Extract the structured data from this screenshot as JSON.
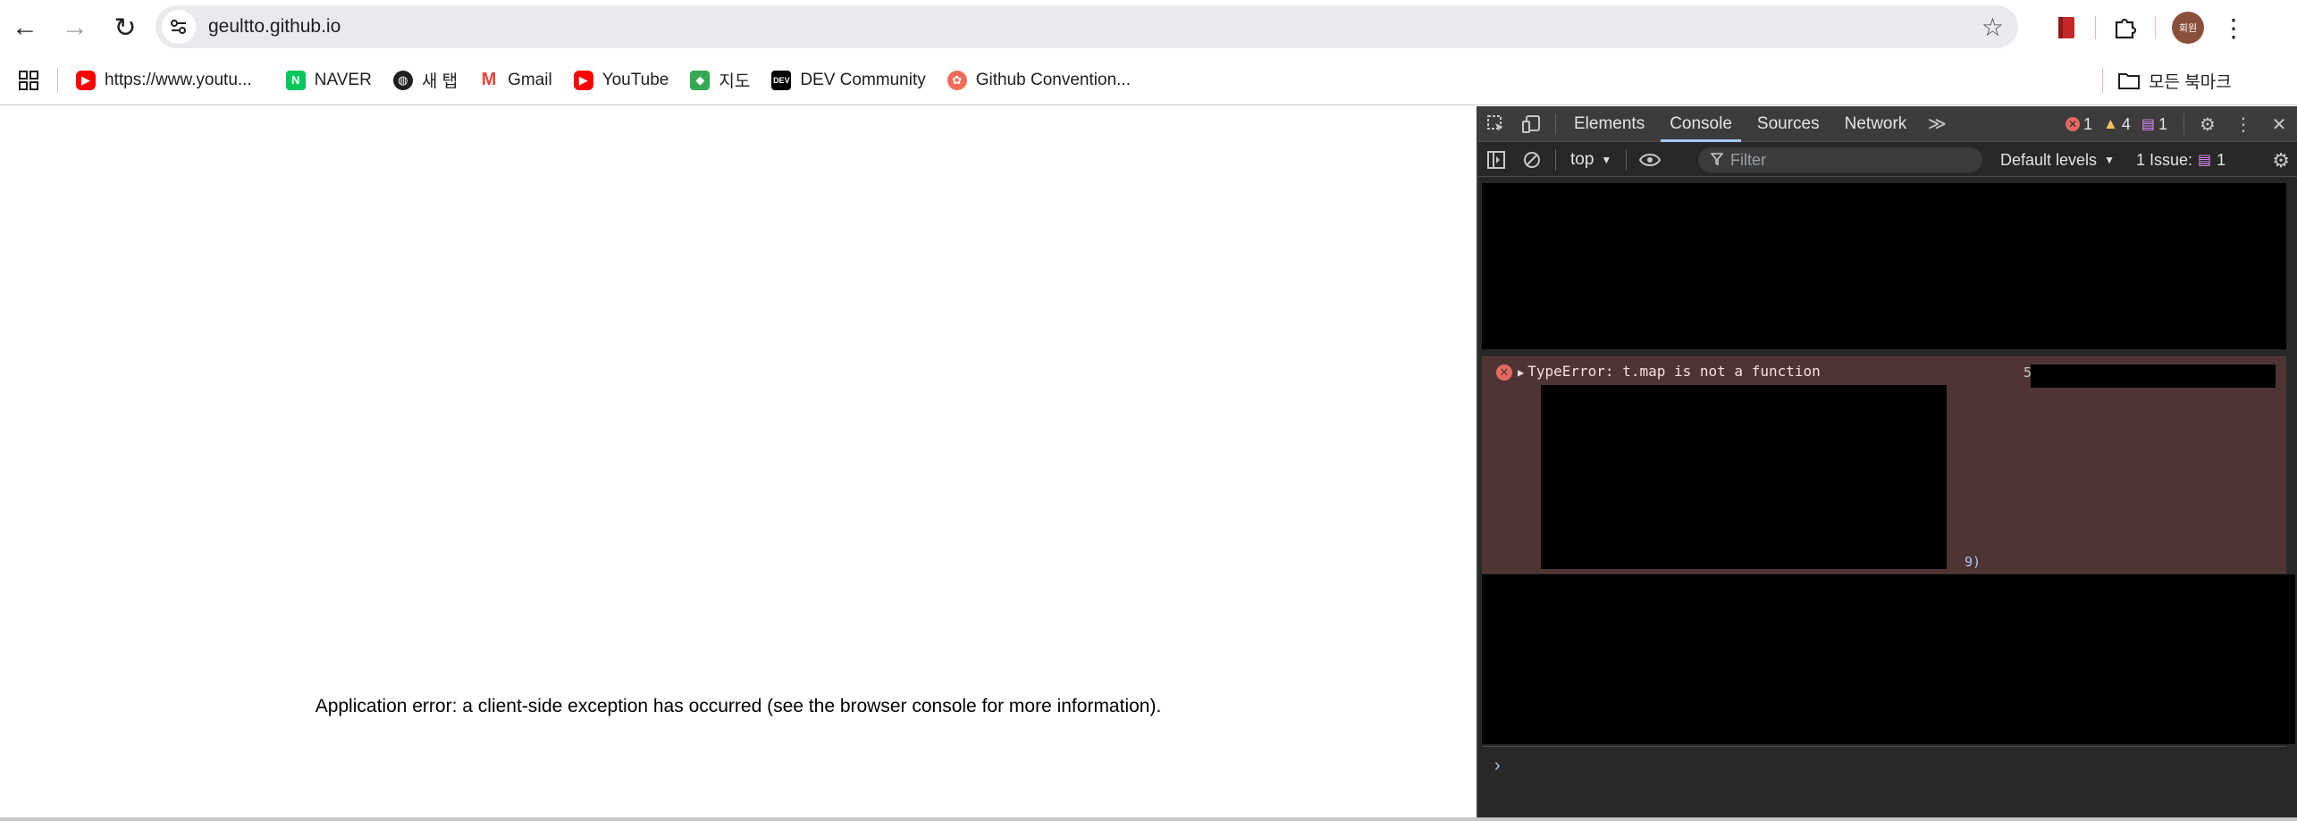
{
  "browser": {
    "url": "geultto.github.io",
    "back_icon": "←",
    "forward_icon": "→",
    "reload_icon": "↻",
    "star_icon": "☆",
    "menu_icon": "⋮",
    "profile_label": "회원"
  },
  "bookmarks": {
    "items": [
      {
        "label": "https://www.youtu...",
        "icon": "youtube-icon",
        "color": "#ff0000"
      },
      {
        "label": "NAVER",
        "icon": "naver-icon",
        "color": "#03c75a"
      },
      {
        "label": "새 탭",
        "icon": "globe-icon",
        "color": "#1f1f1f"
      },
      {
        "label": "Gmail",
        "icon": "gmail-icon",
        "color": "#ea4335"
      },
      {
        "label": "YouTube",
        "icon": "youtube-icon",
        "color": "#ff0000"
      },
      {
        "label": "지도",
        "icon": "maps-icon",
        "color": "#34a853"
      },
      {
        "label": "DEV Community",
        "icon": "dev-icon",
        "color": "#000000"
      },
      {
        "label": "Github Convention...",
        "icon": "github-convention-icon",
        "color": "#f06a5a"
      }
    ],
    "all_bookmarks_label": "모든 북마크"
  },
  "page": {
    "error_text": "Application error: a client-side exception has occurred (see the browser console for more information)."
  },
  "devtools": {
    "tabs": [
      "Elements",
      "Console",
      "Sources",
      "Network"
    ],
    "active_tab": "Console",
    "more_tabs": "≫",
    "error_count": "1",
    "warning_count": "4",
    "issue_count": "1",
    "context": "top",
    "filter_placeholder": "Filter",
    "levels": "Default levels",
    "issues_label": "1 Issue:",
    "issues_badge": "1",
    "error_message": "TypeError: t.map is not a function",
    "error_source_prefix": "5",
    "stack_tail": "9)"
  },
  "colors": {
    "devtools_bg": "#282828",
    "error_row_bg": "#4e3534",
    "error_red": "#e46962",
    "active_tab_underline": "#a8c7fa"
  }
}
